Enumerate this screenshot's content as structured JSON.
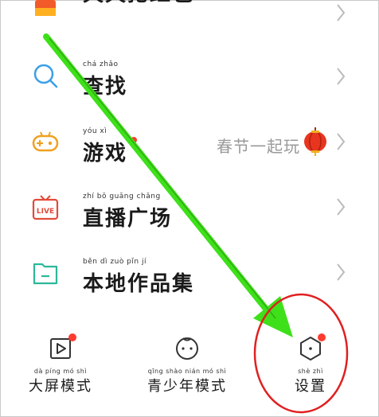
{
  "menu": {
    "items": [
      {
        "label": "天天抢红包",
        "pinyin": "",
        "icon": "red-packet-icon"
      },
      {
        "label": "查找",
        "pinyin": "chá  zhǎo",
        "icon": "search-icon"
      },
      {
        "label": "游戏",
        "pinyin": "yóu  xì",
        "icon": "gamepad-icon",
        "hint": "春节一起玩"
      },
      {
        "label": "直播广场",
        "pinyin": "zhí  bō  guǎng chǎng",
        "icon": "live-tv-icon"
      },
      {
        "label": "本地作品集",
        "pinyin": "běn  dì  zuò  pǐn  jí",
        "icon": "folder-icon"
      }
    ]
  },
  "bottom": {
    "items": [
      {
        "label": "大屏模式",
        "pinyin": "dà píng mó shì",
        "icon": "play-screen-icon"
      },
      {
        "label": "青少年模式",
        "pinyin": "qīng shào nián mó shì",
        "icon": "child-face-icon"
      },
      {
        "label": "设置",
        "pinyin": "shè zhì",
        "icon": "settings-hexagon-icon"
      }
    ]
  },
  "colors": {
    "accent_red": "#ff3b2f",
    "icon_blue": "#3aa0e6",
    "icon_orange": "#f0a020",
    "icon_teal": "#2bb89a",
    "annotation_green": "#3ee01a",
    "annotation_circle": "#e02020"
  }
}
